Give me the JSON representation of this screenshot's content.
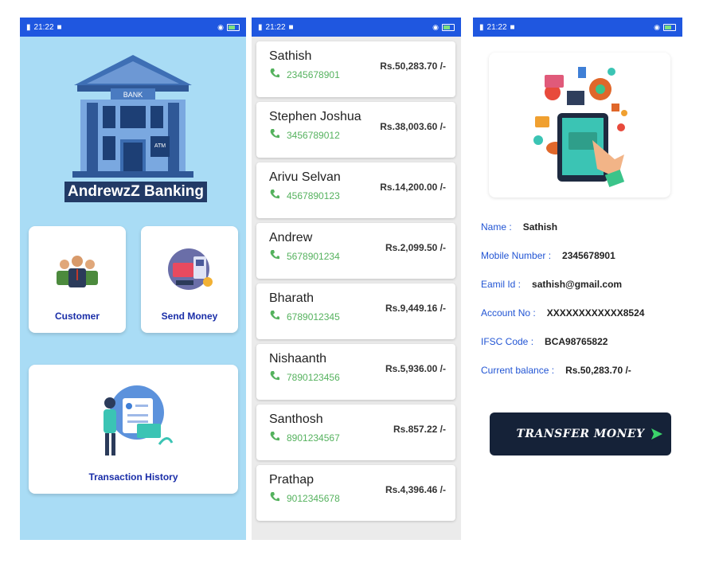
{
  "status_bar": {
    "time": "21:22"
  },
  "home": {
    "app_title": "AndrewzZ Banking",
    "bank_sign": "BANK",
    "atm_sign": "ATM",
    "customer_label": "Customer",
    "send_money_label": "Send Money",
    "transaction_history_label": "Transaction History"
  },
  "customers": [
    {
      "name": "Sathish",
      "phone": "2345678901",
      "balance": "Rs.50,283.70 /-"
    },
    {
      "name": "Stephen Joshua",
      "phone": "3456789012",
      "balance": "Rs.38,003.60 /-"
    },
    {
      "name": "Arivu Selvan",
      "phone": "4567890123",
      "balance": "Rs.14,200.00 /-"
    },
    {
      "name": "Andrew",
      "phone": "5678901234",
      "balance": "Rs.2,099.50 /-"
    },
    {
      "name": "Bharath",
      "phone": "6789012345",
      "balance": "Rs.9,449.16 /-"
    },
    {
      "name": "Nishaanth",
      "phone": "7890123456",
      "balance": "Rs.5,936.00 /-"
    },
    {
      "name": "Santhosh",
      "phone": "8901234567",
      "balance": "Rs.857.22 /-"
    },
    {
      "name": "Prathap",
      "phone": "9012345678",
      "balance": "Rs.4,396.46 /-"
    }
  ],
  "details": {
    "name_label": "Name :",
    "name": "Sathish",
    "mobile_label": "Mobile Number :",
    "mobile": "2345678901",
    "email_label": "Eamil Id :",
    "email": "sathish@gmail.com",
    "account_label": "Account No :",
    "account": "XXXXXXXXXXXX8524",
    "ifsc_label": "IFSC Code :",
    "ifsc": "BCA98765822",
    "balance_label": "Current balance :",
    "balance": "Rs.50,283.70 /-",
    "transfer_label": "TRANSFER MONEY"
  },
  "colors": {
    "status_bar": "#1f57e0",
    "home_bg": "#a9dcf5",
    "accent_text": "#1a2ea8",
    "phone_green": "#55b25e",
    "button_dark": "#152238"
  }
}
